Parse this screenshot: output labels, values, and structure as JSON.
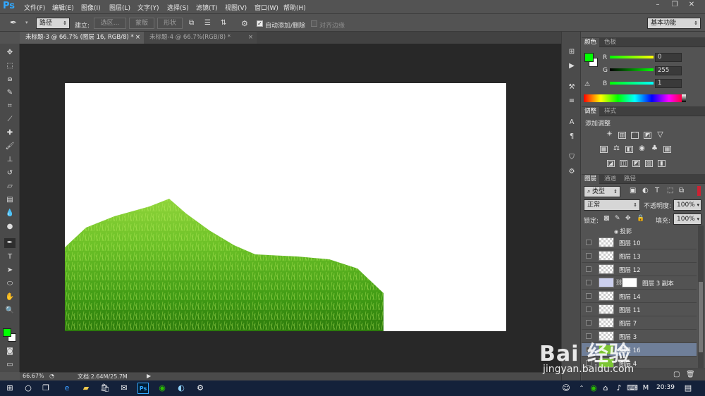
{
  "app": {
    "logo": "Ps"
  },
  "menu": [
    "文件(F)",
    "编辑(E)",
    "图像(I)",
    "图层(L)",
    "文字(Y)",
    "选择(S)",
    "滤镜(T)",
    "视图(V)",
    "窗口(W)",
    "帮助(H)"
  ],
  "options": {
    "mode": "路径",
    "build_label": "建立:",
    "selection_btn": "选区...",
    "mask_btn": "蒙版",
    "shape_btn": "形状",
    "auto_add_label": "自动添加/删除",
    "align_edges_label": "对齐边缘",
    "workspace": "基本功能"
  },
  "tabs": [
    {
      "label": "未标题-3 @ 66.7% (图层 16, RGB/8) *",
      "close": "×"
    },
    {
      "label": "未标题-4 @ 66.7%(RGB/8) *",
      "close": "×"
    }
  ],
  "status": {
    "zoom": "66.67%",
    "doc": "文档:2.64M/25.7M",
    "arrow": "▶"
  },
  "color_panel": {
    "tabs": [
      "颜色",
      "色板"
    ],
    "R": {
      "label": "R",
      "value": "0"
    },
    "G": {
      "label": "G",
      "value": "255"
    },
    "B": {
      "label": "B",
      "value": "1"
    },
    "fg": "#00ff01",
    "bg": "#ffffff"
  },
  "adjust_panel": {
    "tabs": [
      "调整",
      "样式"
    ],
    "title": "添加调整"
  },
  "layers_panel": {
    "tabs": [
      "图层",
      "通道",
      "路径"
    ],
    "filter": "类型",
    "blend": "正常",
    "opacity_label": "不透明度:",
    "opacity": "100%",
    "lock_label": "锁定:",
    "fill_label": "填充:",
    "fill": "100%",
    "effect": "投影",
    "layers": [
      "图层 10",
      "图层 13",
      "图层 12",
      "图层 3 副本",
      "图层 14",
      "图层 11",
      "图层 7",
      "图层 3",
      "图层 16",
      "图层 4"
    ]
  },
  "watermark": {
    "brand": "Bai 经验",
    "url": "jingyan.baidu.com"
  },
  "taskbar": {
    "time": "20:39"
  }
}
